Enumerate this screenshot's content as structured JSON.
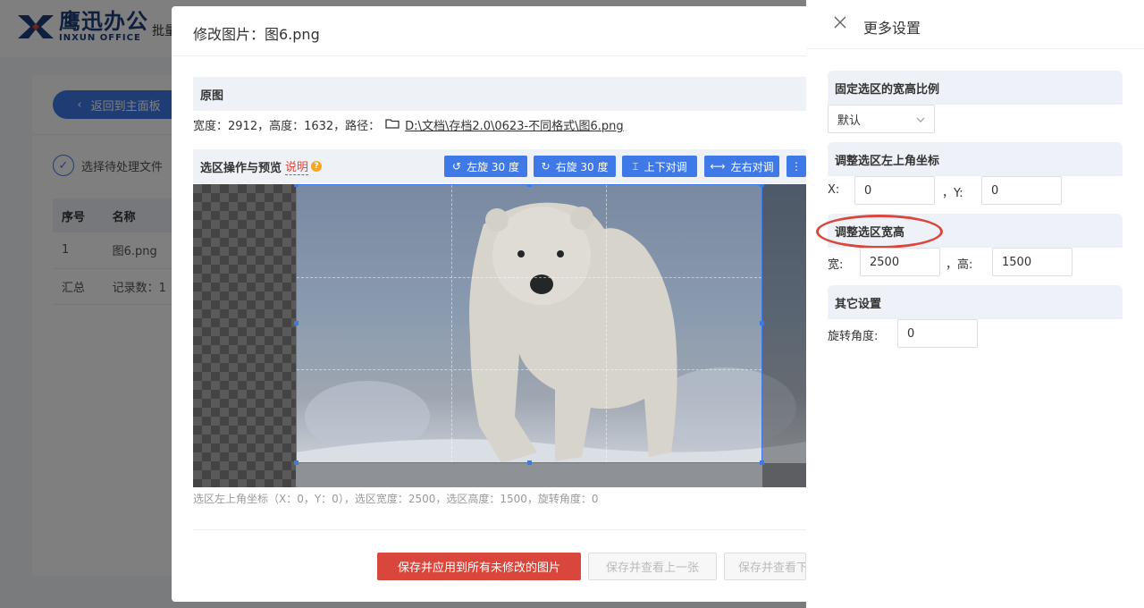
{
  "app": {
    "logo_cn": "鹰迅办公",
    "logo_en": "INXUN OFFICE",
    "header_partial": "批量"
  },
  "left": {
    "back_label": "返回到主面板",
    "step_label": "选择待处理文件",
    "table": {
      "headers": [
        "序号",
        "名称"
      ],
      "rows": [
        [
          "1",
          "图6.png"
        ],
        [
          "汇总",
          "记录数：1"
        ]
      ]
    }
  },
  "modal": {
    "title": "修改图片：图6.png",
    "original_section": "原图",
    "info_prefix": "宽度：2912，高度：1632，路径：",
    "path": "D:\\文档\\存档2.0\\0623-不同格式\\图6.png",
    "preview_section": "选区操作与预览",
    "help_link": "说明",
    "help_icon_text": "?",
    "toolbar": [
      {
        "label": "左旋 30 度",
        "icon": "rotate-left-icon",
        "glyph": "↺"
      },
      {
        "label": "右旋 30 度",
        "icon": "rotate-right-icon",
        "glyph": "↻"
      },
      {
        "label": "上下对调",
        "icon": "flip-vertical-icon",
        "glyph": "⌶"
      },
      {
        "label": "左右对调",
        "icon": "flip-horizontal-icon",
        "glyph": "⟷"
      },
      {
        "label": "",
        "icon": "more-icon",
        "glyph": "⋮"
      }
    ],
    "caption": "选区左上角坐标（X：0，Y：0），选区宽度：2500，选区高度：1500，旋转角度：0",
    "buttons": {
      "apply_all": "保存并应用到所有未修改的图片",
      "prev": "保存并查看上一张",
      "next": "保存并查看下"
    }
  },
  "drawer": {
    "title": "更多设置",
    "ratio_section": "固定选区的宽高比例",
    "ratio_value": "默认",
    "coord_section": "调整选区左上角坐标",
    "x_label": "X:",
    "x_value": "0",
    "y_label": "，Y:",
    "y_value": "0",
    "size_section": "调整选区宽高",
    "w_label": "宽:",
    "w_value": "2500",
    "h_label": "，高:",
    "h_value": "1500",
    "other_section": "其它设置",
    "rotate_label": "旋转角度:",
    "rotate_value": "0"
  },
  "colors": {
    "primary": "#3f79e8",
    "danger": "#d9463c",
    "highlight_ellipse": "#d9463c"
  }
}
